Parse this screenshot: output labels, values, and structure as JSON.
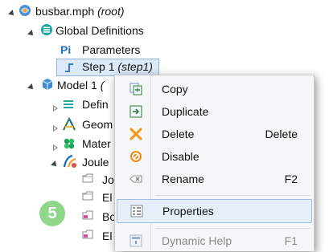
{
  "tree": {
    "root_label": "busbar.mph",
    "root_suffix": "(root)",
    "global_definitions": "Global Definitions",
    "parameters": "Parameters",
    "parameters_icon_text": "Pi",
    "step_label": "Step 1",
    "step_suffix": "(step1)",
    "model_label": "Model 1",
    "model_suffix": "(",
    "definitions": "Defin",
    "geometry": "Geom",
    "materials": "Mater",
    "joule": "Joule",
    "child_1": "Jo",
    "child_2": "El",
    "child_3": "Bo",
    "child_4": "El"
  },
  "step_badge": "5",
  "context_menu": {
    "items": [
      {
        "label": "Copy",
        "shortcut": "",
        "icon": "copy-icon"
      },
      {
        "label": "Duplicate",
        "shortcut": "",
        "icon": "duplicate-icon"
      },
      {
        "label": "Delete",
        "shortcut": "Delete",
        "icon": "delete-icon"
      },
      {
        "label": "Disable",
        "shortcut": "",
        "icon": "disable-icon"
      },
      {
        "label": "Rename",
        "shortcut": "F2",
        "icon": "rename-icon"
      },
      {
        "label": "Properties",
        "shortcut": "",
        "icon": "properties-icon"
      },
      {
        "label": "Dynamic Help",
        "shortcut": "F1",
        "icon": "help-icon"
      }
    ]
  },
  "colors": {
    "selection_bg": "#dbe9f9",
    "badge": "#8fd88a",
    "delete_x": "#f39a1d",
    "disable": "#f38a1d"
  }
}
